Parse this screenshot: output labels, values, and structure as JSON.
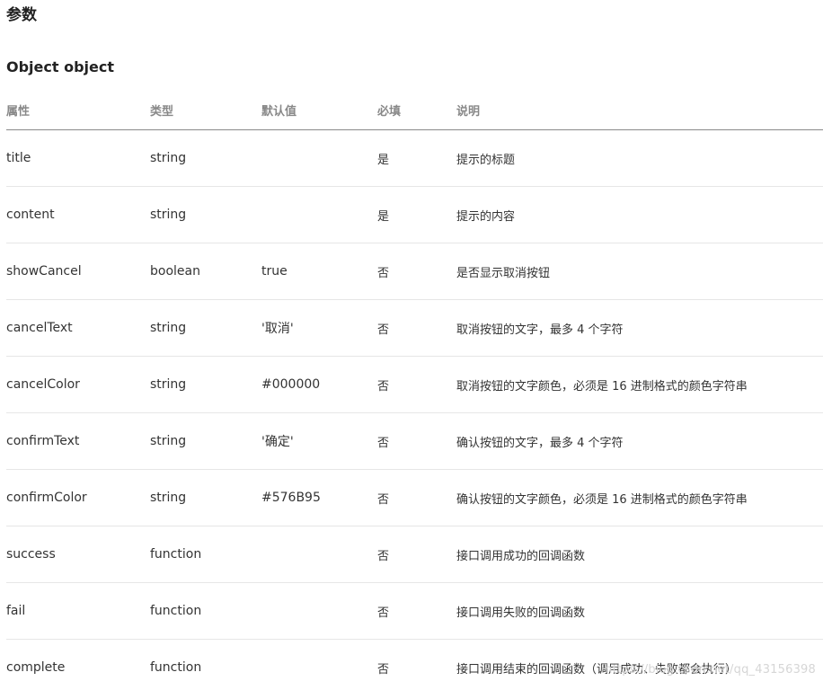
{
  "section_title": "参数",
  "subsection_title": "Object object",
  "table": {
    "headers": [
      "属性",
      "类型",
      "默认值",
      "必填",
      "说明"
    ],
    "rows": [
      {
        "name": "title",
        "type": "string",
        "default": "",
        "required": "是",
        "desc": "提示的标题"
      },
      {
        "name": "content",
        "type": "string",
        "default": "",
        "required": "是",
        "desc": "提示的内容"
      },
      {
        "name": "showCancel",
        "type": "boolean",
        "default": "true",
        "required": "否",
        "desc": "是否显示取消按钮"
      },
      {
        "name": "cancelText",
        "type": "string",
        "default": "'取消'",
        "required": "否",
        "desc": "取消按钮的文字，最多 4 个字符"
      },
      {
        "name": "cancelColor",
        "type": "string",
        "default": "#000000",
        "required": "否",
        "desc": "取消按钮的文字颜色，必须是 16 进制格式的颜色字符串"
      },
      {
        "name": "confirmText",
        "type": "string",
        "default": "'确定'",
        "required": "否",
        "desc": "确认按钮的文字，最多 4 个字符"
      },
      {
        "name": "confirmColor",
        "type": "string",
        "default": "#576B95",
        "required": "否",
        "desc": "确认按钮的文字颜色，必须是 16 进制格式的颜色字符串"
      },
      {
        "name": "success",
        "type": "function",
        "default": "",
        "required": "否",
        "desc": "接口调用成功的回调函数"
      },
      {
        "name": "fail",
        "type": "function",
        "default": "",
        "required": "否",
        "desc": "接口调用失败的回调函数"
      },
      {
        "name": "complete",
        "type": "function",
        "default": "",
        "required": "否",
        "desc": "接口调用结束的回调函数（调用成功、失败都会执行）"
      }
    ]
  },
  "watermark": "https://blog.csdn.net/qq_43156398"
}
